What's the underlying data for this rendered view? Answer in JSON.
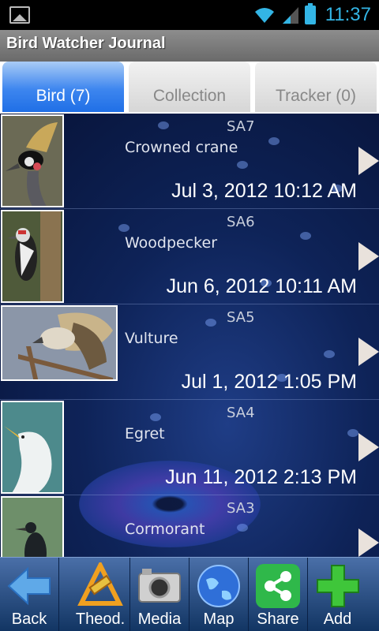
{
  "status_bar": {
    "time": "11:37",
    "icons": [
      "image-icon",
      "wifi-icon",
      "signal-icon",
      "battery-icon"
    ]
  },
  "title_bar": {
    "title": "Bird Watcher Journal"
  },
  "tabs": [
    {
      "label": "Bird (7)",
      "active": true
    },
    {
      "label": "Collection",
      "active": false
    },
    {
      "label": "Tracker (0)",
      "active": false
    }
  ],
  "entries": [
    {
      "code": "SA7",
      "name": "Crowned crane",
      "datetime": "Jul 3, 2012 10:12 AM",
      "thumb": "crowned-crane-photo"
    },
    {
      "code": "SA6",
      "name": "Woodpecker",
      "datetime": "Jun 6, 2012 10:11 AM",
      "thumb": "woodpecker-photo"
    },
    {
      "code": "SA5",
      "name": "Vulture",
      "datetime": "Jul 1, 2012 1:05 PM",
      "thumb": "vulture-photo"
    },
    {
      "code": "SA4",
      "name": "Egret",
      "datetime": "Jun 11, 2012 2:13 PM",
      "thumb": "egret-photo"
    },
    {
      "code": "SA3",
      "name": "Cormorant",
      "datetime": "",
      "thumb": "cormorant-photo"
    }
  ],
  "bottom_bar": [
    {
      "label": "Back",
      "icon": "back-arrow-icon"
    },
    {
      "label": "Theod.",
      "icon": "theodolite-icon"
    },
    {
      "label": "Media",
      "icon": "camera-icon"
    },
    {
      "label": "Map",
      "icon": "globe-icon"
    },
    {
      "label": "Share",
      "icon": "share-icon"
    },
    {
      "label": "Add",
      "icon": "plus-icon"
    }
  ],
  "colors": {
    "accent": "#33b5e5",
    "tab_active": "#3e86ef",
    "list_bg": "#0e2358",
    "bottom_bar": "#123563"
  }
}
